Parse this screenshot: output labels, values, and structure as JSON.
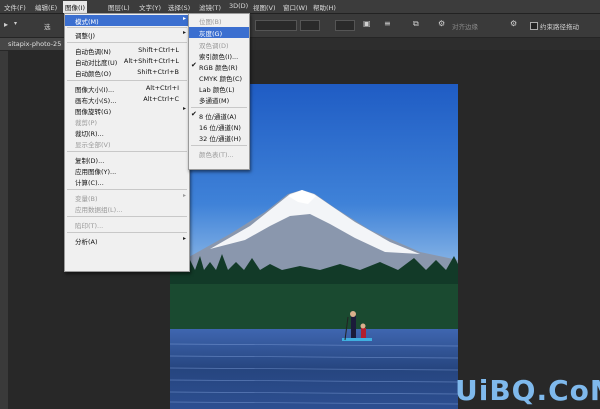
{
  "menubar": {
    "items": [
      {
        "label": "文件(F)"
      },
      {
        "label": "编辑(E)"
      },
      {
        "label": "图像(I)"
      },
      {
        "label": "图层(L)"
      },
      {
        "label": "文字(Y)"
      },
      {
        "label": "选择(S)"
      },
      {
        "label": "滤镜(T)"
      },
      {
        "label": "3D(D)"
      },
      {
        "label": "视图(V)"
      },
      {
        "label": "窗口(W)"
      },
      {
        "label": "帮助(H)"
      }
    ]
  },
  "optbar": {
    "select_label": "选",
    "align_label": "对齐边缘",
    "constrain_label": "约束路径拖动"
  },
  "document_tab": {
    "label": "sitapix-photo-25"
  },
  "image_menu": {
    "items": [
      {
        "label": "模式(M)",
        "shortcut": "",
        "submenu": true,
        "highlight": true
      },
      {
        "label": "调整(J)",
        "shortcut": "",
        "submenu": true
      },
      {
        "label": "自动色调(N)",
        "shortcut": "Shift+Ctrl+L"
      },
      {
        "label": "自动对比度(U)",
        "shortcut": "Alt+Shift+Ctrl+L"
      },
      {
        "label": "自动颜色(O)",
        "shortcut": "Shift+Ctrl+B"
      },
      {
        "label": "图像大小(I)...",
        "shortcut": "Alt+Ctrl+I"
      },
      {
        "label": "画布大小(S)...",
        "shortcut": "Alt+Ctrl+C"
      },
      {
        "label": "图像旋转(G)",
        "shortcut": "",
        "submenu": true
      },
      {
        "label": "裁剪(P)",
        "shortcut": "",
        "disabled": true
      },
      {
        "label": "裁切(R)...",
        "shortcut": ""
      },
      {
        "label": "显示全部(V)",
        "shortcut": "",
        "disabled": true
      },
      {
        "label": "复制(D)...",
        "shortcut": ""
      },
      {
        "label": "应用图像(Y)...",
        "shortcut": ""
      },
      {
        "label": "计算(C)...",
        "shortcut": ""
      },
      {
        "label": "变量(B)",
        "shortcut": "",
        "submenu": true,
        "disabled": true
      },
      {
        "label": "应用数据组(L)...",
        "shortcut": "",
        "disabled": true
      },
      {
        "label": "陷印(T)...",
        "shortcut": "",
        "disabled": true
      },
      {
        "label": "分析(A)",
        "shortcut": "",
        "submenu": true
      }
    ]
  },
  "mode_menu": {
    "items": [
      {
        "label": "位图(B)",
        "disabled": true
      },
      {
        "label": "灰度(G)",
        "highlight": true
      },
      {
        "label": "双色调(D)",
        "disabled": true
      },
      {
        "label": "索引颜色(I)..."
      },
      {
        "label": "RGB 颜色(R)",
        "checked": true
      },
      {
        "label": "CMYK 颜色(C)"
      },
      {
        "label": "Lab 颜色(L)"
      },
      {
        "label": "多通道(M)"
      },
      {
        "label": "8 位/通道(A)",
        "checked": true
      },
      {
        "label": "16 位/通道(N)"
      },
      {
        "label": "32 位/通道(H)"
      },
      {
        "label": "颜色表(T)...",
        "disabled": true
      }
    ]
  },
  "watermark": {
    "text": "UiBQ.CoM"
  },
  "colors": {
    "menu_highlight": "#3b6fd0",
    "app_bg": "#282828",
    "watermark": "#7fb9ec"
  }
}
